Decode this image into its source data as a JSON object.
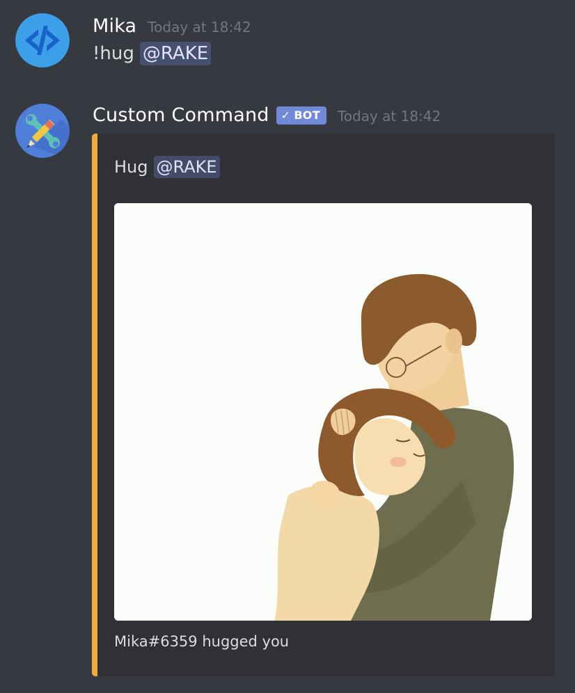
{
  "messages": [
    {
      "author": "Mika",
      "timestamp": "Today at 18:42",
      "text": "!hug",
      "mention": "@RAKE",
      "avatar_icon": "code-brackets-icon"
    },
    {
      "author": "Custom Command",
      "bot_tag": "BOT",
      "timestamp": "Today at 18:42",
      "avatar_icon": "pencil-wrench-icon",
      "embed": {
        "accent_color": "#f0ab3a",
        "description": "Hug",
        "mention": "@RAKE",
        "image_subject": "hug-illustration",
        "footer": "Mika#6359 hugged you"
      }
    }
  ],
  "colors": {
    "background": "#36393f",
    "embed_background": "#2f3136",
    "mention_background": "#414675",
    "bot_tag": "#7289da",
    "timestamp": "#72767d"
  }
}
